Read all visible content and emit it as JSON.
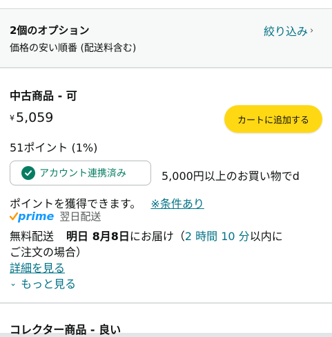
{
  "header": {
    "title": "2個のオプション",
    "sort": "価格の安い順番 (配送料含む)",
    "filter": "絞り込み",
    "filter_icon": "chevron-right-icon"
  },
  "offer": {
    "condition": "中古商品 - 可",
    "price_symbol": "¥",
    "price": "5,059",
    "points": "51ポイント (1%)",
    "cart_button": "カートに追加する",
    "badge": "アカウント連携済み",
    "badge_icon": "check-circle-icon",
    "promo_line1": "5,000円以上のお買い物でd",
    "promo_line2": "ポイントを獲得できます。",
    "promo_link": "※条件あり",
    "prime_word": "prime",
    "prime_next_day": "翌日配送",
    "free_shipping": "無料配送",
    "delivery_date": "明日 8月8日",
    "delivery_suffix": "にお届け（",
    "order_within": "2 時間 10 分",
    "within_suffix": "以内に",
    "order_note": "ご注文の場合）",
    "details_link": "詳細を見る",
    "more_link": "もっと見る"
  },
  "offer2": {
    "condition": "コレクター商品 - 良い"
  },
  "colors": {
    "accent": "#007185",
    "button": "#ffd814",
    "green": "#067d62",
    "prime_blue": "#1399ff",
    "prime_orange": "#ff9900"
  }
}
